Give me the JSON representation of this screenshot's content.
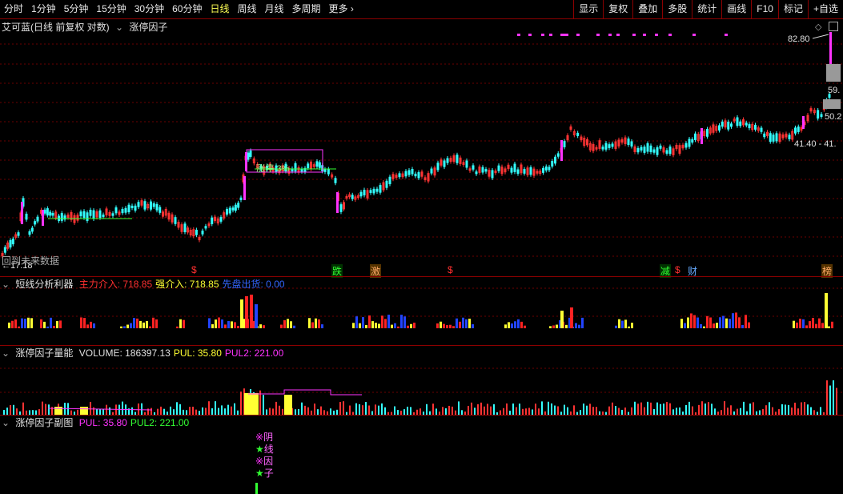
{
  "toolbar": {
    "periods": [
      "分时",
      "1分钟",
      "5分钟",
      "15分钟",
      "30分钟",
      "60分钟",
      "日线",
      "周线",
      "月线",
      "多周期",
      "更多"
    ],
    "active_period": "日线",
    "more_arrow": "›",
    "right_buttons": [
      "显示",
      "复权",
      "叠加",
      "多股",
      "统计",
      "画线",
      "F10",
      "标记",
      "+自选"
    ]
  },
  "main": {
    "title": "艾可蓝(日线 前复权 对数)",
    "indicator": "涨停因子",
    "price_labels": {
      "top": "82.80",
      "mid1": "59.",
      "mid2": "50.2",
      "range": "41.40 - 41.",
      "low": "←17.18"
    },
    "overlay_text": "回到未来数据",
    "zt_label": "涨停-3%",
    "markers": [
      {
        "text": "$",
        "color": "#ff3030"
      },
      {
        "text": "跌",
        "color": "#33ff33",
        "bg": "#003300"
      },
      {
        "text": "激",
        "color": "#ffaa66",
        "bg": "#553300"
      },
      {
        "text": "$",
        "color": "#ff3030"
      },
      {
        "text": "减",
        "color": "#33ff33",
        "bg": "#003300"
      },
      {
        "text": "$",
        "color": "#ff3030"
      },
      {
        "text": "财",
        "color": "#66aaff"
      },
      {
        "text": "榜",
        "color": "#ffaa66",
        "bg": "#553300"
      }
    ]
  },
  "panel1": {
    "title": "短线分析利器",
    "items": [
      {
        "label": "主力介入:",
        "value": "718.85",
        "color": "#ff3030"
      },
      {
        "label": "强介入:",
        "value": "718.85",
        "color": "#ffff33"
      },
      {
        "label": "先盘出货:",
        "value": "0.00",
        "color": "#3366ff"
      }
    ]
  },
  "panel2": {
    "title": "涨停因子量能",
    "items": [
      {
        "label": "VOLUME:",
        "value": "186397.13",
        "color": "#e0e0e0"
      },
      {
        "label": "PUL:",
        "value": "35.80",
        "color": "#ffff33"
      },
      {
        "label": "PUL2:",
        "value": "221.00",
        "color": "#ff33ff"
      }
    ]
  },
  "panel3": {
    "title": "涨停因子副图",
    "items": [
      {
        "label": "PUL:",
        "value": "35.80",
        "color": "#ff33ff"
      },
      {
        "label": "PUL2:",
        "value": "221.00",
        "color": "#33ff33"
      }
    ],
    "signal_chars": [
      "※阴",
      "★线",
      "※因",
      "★子"
    ]
  },
  "colors": {
    "up": "#ff3333",
    "down": "#33ffff",
    "magenta": "#ff33ff",
    "grid": "#8b0000"
  }
}
